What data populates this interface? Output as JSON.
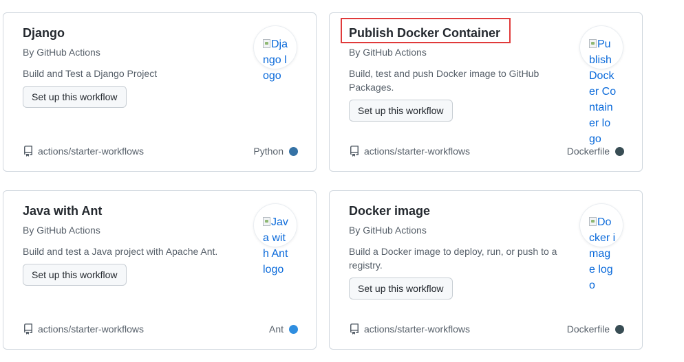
{
  "cards": [
    {
      "title": "Django",
      "author": "By GitHub Actions",
      "description": "Build and Test a Django Project",
      "button": "Set up this workflow",
      "logo_alt": "Django logo",
      "repo": "actions/starter-workflows",
      "language": "Python",
      "language_color": "#3572A5"
    },
    {
      "title": "Publish Docker Container",
      "author": "By GitHub Actions",
      "description": "Build, test and push Docker image to GitHub Packages.",
      "button": "Set up this workflow",
      "logo_alt": "Publish Docker Container logo",
      "repo": "actions/starter-workflows",
      "language": "Dockerfile",
      "language_color": "#384d54"
    },
    {
      "title": "Java with Ant",
      "author": "By GitHub Actions",
      "description": "Build and test a Java project with Apache Ant.",
      "button": "Set up this workflow",
      "logo_alt": "Java with Ant logo",
      "repo": "actions/starter-workflows",
      "language": "Ant",
      "language_color": "#2f8ee0"
    },
    {
      "title": "Docker image",
      "author": "By GitHub Actions",
      "description": "Build a Docker image to deploy, run, or push to a registry.",
      "button": "Set up this workflow",
      "logo_alt": "Docker image logo",
      "repo": "actions/starter-workflows",
      "language": "Dockerfile",
      "language_color": "#384d54"
    }
  ],
  "icons": {
    "repo": "repo-icon",
    "broken_image": "broken-image-icon"
  },
  "highlight_color": "#e03a3a"
}
